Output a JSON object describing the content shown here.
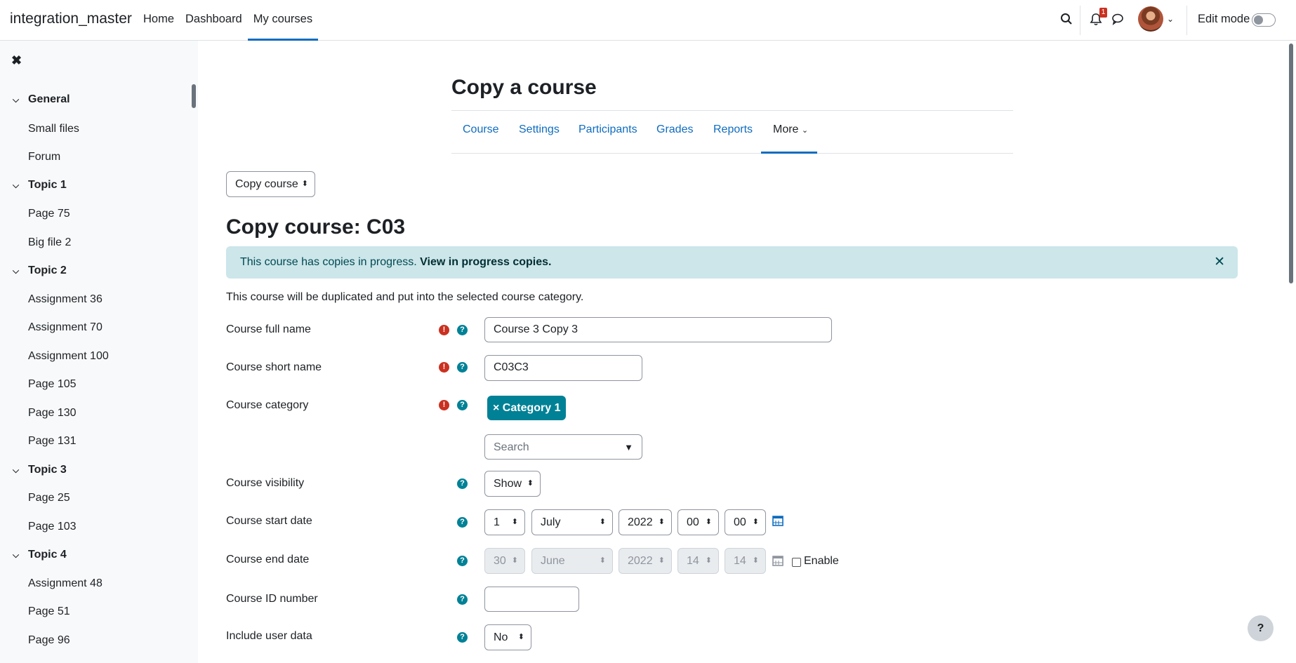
{
  "navbar": {
    "brand": "integration_master",
    "links": [
      "Home",
      "Dashboard",
      "My courses"
    ],
    "active_link": "My courses",
    "notification_count": "1",
    "edit_mode_label": "Edit mode",
    "edit_mode_on": false
  },
  "sidebar": {
    "close_label": "✖",
    "sections": [
      {
        "label": "General",
        "items": [
          "Small files",
          "Forum"
        ]
      },
      {
        "label": "Topic 1",
        "items": [
          "Page 75",
          "Big file 2"
        ]
      },
      {
        "label": "Topic 2",
        "items": [
          "Assignment 36",
          "Assignment 70",
          "Assignment 100",
          "Page 105",
          "Page 130",
          "Page 131"
        ]
      },
      {
        "label": "Topic 3",
        "items": [
          "Page 25",
          "Page 103"
        ]
      },
      {
        "label": "Topic 4",
        "items": [
          "Assignment 48",
          "Page 51",
          "Page 96"
        ]
      }
    ]
  },
  "page": {
    "title": "Copy a course",
    "secondary_nav": [
      "Course",
      "Settings",
      "Participants",
      "Grades",
      "Reports",
      "More"
    ],
    "action_select": "Copy course",
    "heading": "Copy course: C03",
    "alert": {
      "text": "This course has copies in progress.",
      "link": "View in progress copies.",
      "close": "✕"
    },
    "intro": "This course will be duplicated and put into the selected course category."
  },
  "form": {
    "full_name": {
      "label": "Course full name",
      "value": "Course 3 Copy 3"
    },
    "short_name": {
      "label": "Course short name",
      "value": "C03C3"
    },
    "category": {
      "label": "Course category",
      "tag": "× Category 1",
      "search_placeholder": "Search"
    },
    "visibility": {
      "label": "Course visibility",
      "value": "Show"
    },
    "start_date": {
      "label": "Course start date",
      "day": "1",
      "month": "July",
      "year": "2022",
      "hour": "00",
      "minute": "00"
    },
    "end_date": {
      "label": "Course end date",
      "day": "30",
      "month": "June",
      "year": "2022",
      "hour": "14",
      "minute": "14",
      "enable_label": "Enable",
      "enabled": false
    },
    "id_number": {
      "label": "Course ID number",
      "value": ""
    },
    "user_data": {
      "label": "Include user data",
      "value": "No"
    }
  },
  "help_button": "?"
}
